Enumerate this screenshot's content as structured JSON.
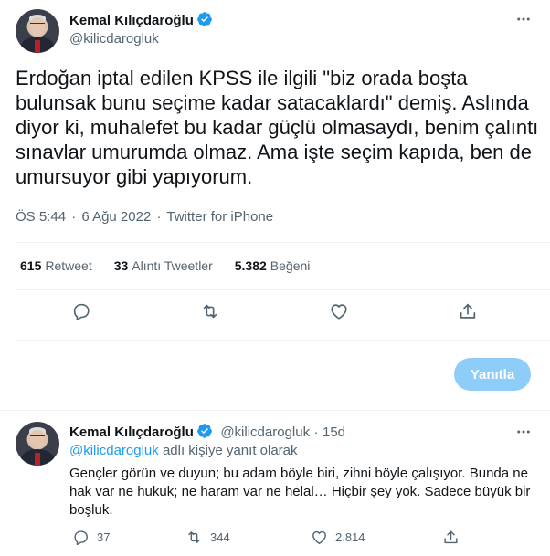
{
  "main_tweet": {
    "author_name": "Kemal Kılıçdaroğlu",
    "author_handle": "@kilicdarogluk",
    "text": "Erdoğan iptal edilen KPSS ile ilgili \"biz orada boşta bulunsak bunu seçime kadar satacaklardı\" demiş. Aslında diyor ki, muhalefet bu kadar güçlü olmasaydı, benim çalıntı sınavlar umurumda olmaz. Ama işte seçim kapıda, ben de umursuyor gibi yapıyorum.",
    "time": "ÖS 5:44",
    "date": "6 Ağu 2022",
    "separator": "·",
    "source": "Twitter for iPhone",
    "stats": [
      {
        "count": "615",
        "label": "Retweet"
      },
      {
        "count": "33",
        "label": "Alıntı Tweetler"
      },
      {
        "count": "5.382",
        "label": "Beğeni"
      }
    ],
    "actions": [
      "reply-icon",
      "retweet-icon",
      "like-icon",
      "share-icon"
    ]
  },
  "reply_button_label": "Yanıtla",
  "reply_tweet": {
    "author_name": "Kemal Kılıçdaroğlu",
    "author_handle": "@kilicdarogluk",
    "separator": "·",
    "age": "15d",
    "replying_mention": "@kilicdarogluk",
    "replying_suffix": "adlı kişiye yanıt olarak",
    "text": "Gençler görün ve duyun; bu adam böyle biri, zihni böyle çalışıyor. Bunda ne hak var ne hukuk; ne haram var ne helal… Hiçbir şey yok. Sadece büyük bir boşluk.",
    "reply_count": "37",
    "retweet_count": "344",
    "like_count": "2.814"
  },
  "colors": {
    "accent": "#1d9bf0",
    "reply_button_disabled": "#8ecdf8",
    "secondary_text": "#536471",
    "divider": "#eff3f4"
  }
}
